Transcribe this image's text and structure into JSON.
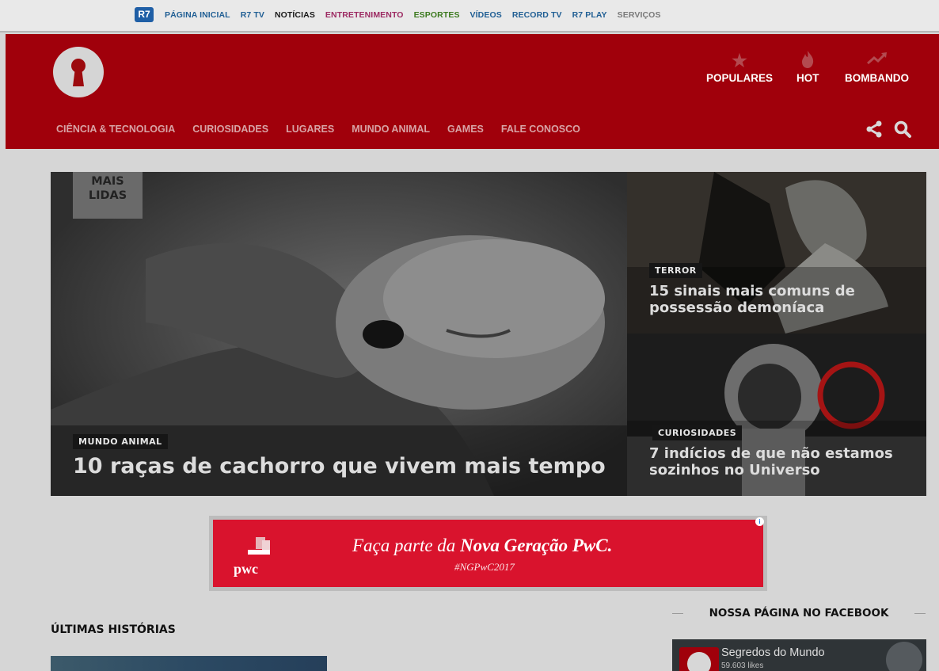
{
  "r7bar": {
    "logo": "R7",
    "links": [
      {
        "label": "PÁGINA INICIAL",
        "color": "#215f94"
      },
      {
        "label": "R7 TV",
        "color": "#215f94"
      },
      {
        "label": "NOTÍCIAS",
        "color": "#1a1a1a"
      },
      {
        "label": "ENTRETENIMENTO",
        "color": "#9c2a62"
      },
      {
        "label": "ESPORTES",
        "color": "#3c7a1f"
      },
      {
        "label": "VÍDEOS",
        "color": "#215f94"
      },
      {
        "label": "RECORD TV",
        "color": "#215f94"
      },
      {
        "label": "R7 PLAY",
        "color": "#215f94"
      },
      {
        "label": "SERVIÇOS",
        "color": "#7a7a7a"
      }
    ]
  },
  "header": {
    "brand_color": "#a0000b",
    "top_nav": [
      {
        "label": "POPULARES",
        "icon": "star-icon"
      },
      {
        "label": "HOT",
        "icon": "flame-icon"
      },
      {
        "label": "BOMBANDO",
        "icon": "trending-icon"
      }
    ],
    "categories": [
      "CIÊNCIA & TECNOLOGIA",
      "CURIOSIDADES",
      "LUGARES",
      "MUNDO ANIMAL",
      "GAMES",
      "FALE CONOSCO"
    ]
  },
  "hero": {
    "section_label": "MAIS LIDAS",
    "main": {
      "category": "MUNDO ANIMAL",
      "title": "10 raças de cachorro que vivem mais tempo"
    },
    "side": [
      {
        "category": "TERROR",
        "title": "15 sinais mais comuns de possessão demoníaca"
      },
      {
        "category": "CURIOSIDADES",
        "title": "7 indícios de que não estamos sozinhos no Universo"
      }
    ]
  },
  "ad": {
    "logo_text": "pwc",
    "headline_prefix": "Faça parte da ",
    "headline_bold": "Nova Geração PwC.",
    "hashtag": "#NGPwC2017",
    "info": "i"
  },
  "latest": {
    "title": "ÚLTIMAS HISTÓRIAS"
  },
  "facebook": {
    "title": "NOSSA PÁGINA NO FACEBOOK",
    "page_name": "Segredos do Mundo",
    "likes": "59.603 likes"
  }
}
